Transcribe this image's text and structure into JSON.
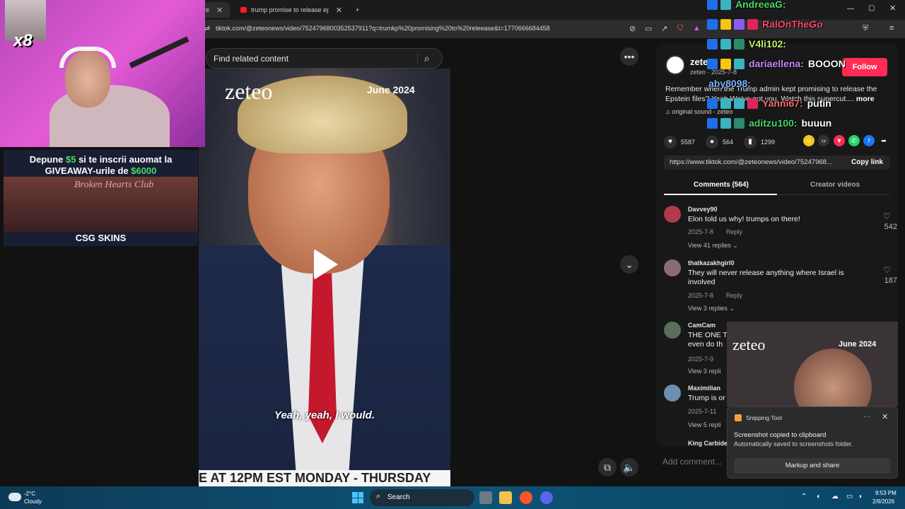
{
  "browser": {
    "tabs": [
      {
        "label": "re",
        "active": true
      },
      {
        "label": "trump promise to release epstein file",
        "active": false
      }
    ],
    "new_tab": "+",
    "url": "tiktok.com/@zeteonews/video/7524796800352537911?q=trumkp%20promising%20to%20releease&t=1770666684458"
  },
  "search": {
    "placeholder": "Find related content"
  },
  "video": {
    "brand": "zeteo",
    "date": "June 2024",
    "caption": "Yeah, yeah, I would.",
    "ticker": "E AT 12PM EST MONDAY - THURSDAY"
  },
  "post": {
    "author": "zete",
    "author_sub": "zeteo · 2025-7-8",
    "follow_label": "Follow",
    "description": "Remember when the Trump admin kept promising to release the Epstein files? Yeah We've got you. Watch this supercut....",
    "more_label": "more",
    "sound": "original sound - zeteo",
    "stats": {
      "likes": "5587",
      "comments": "564",
      "saves": "1299"
    },
    "link": "https://www.tiktok.com/@zeteonews/video/75247968...",
    "copy_link": "Copy link",
    "tab_comments": "Comments (564)",
    "tab_creator": "Creator videos",
    "add_comment": "Add comment..."
  },
  "comments": [
    {
      "user": "Davvey90",
      "text": "Elon told us why! trumps on there!",
      "date": "2025-7-8",
      "reply": "Reply",
      "replies": "View 41 replies",
      "likes": "542",
      "color": "#b23a48"
    },
    {
      "user": "thatkazakhgirl0",
      "text": "They will never release anything where Israel is involved",
      "date": "2025-7-8",
      "reply": "Reply",
      "replies": "View 3 replies",
      "likes": "187",
      "color": "#8a6c73"
    },
    {
      "user": "CamCam",
      "text": "THE ONE T even do th",
      "date": "2025-7-9",
      "reply": "",
      "replies": "View 3 repli",
      "likes": "",
      "color": "#596f5a"
    },
    {
      "user": "Maximilian",
      "text": "Trump is or",
      "date": "2025-7-11",
      "reply": "",
      "replies": "View 5 repli",
      "likes": "",
      "color": "#6c8fb0"
    },
    {
      "user": "King Carbide",
      "text": "",
      "date": "",
      "reply": "",
      "replies": "",
      "likes": "",
      "color": "#777777"
    }
  ],
  "overlay": {
    "cam_multiplier": "x8",
    "ad": {
      "line1_a": "Depune ",
      "line1_b": "$5",
      "line1_c": " si te inscrii auomat la",
      "line2_a": "GIVEAWAY-urile de ",
      "line2_b": "$6000",
      "club": "Broken Hearts Club",
      "brand": "CSG SKINS"
    },
    "chat": [
      {
        "user": "AndreeaG:",
        "msg": "",
        "color": "#4ad96a"
      },
      {
        "user": "RalOnTheGo",
        "msg": "",
        "color": "#ff4d6d"
      },
      {
        "user": "V4li102:",
        "msg": "",
        "color": "#bff36a"
      },
      {
        "user": "dariaellena:",
        "msg": "BOOON",
        "color": "#c58cff"
      },
      {
        "user": "aby8098:",
        "msg": "",
        "color": "#7fb5ff"
      },
      {
        "user": "Yanni67:",
        "msg": "putin",
        "color": "#ff6b6b"
      },
      {
        "user": "aditzu100:",
        "msg": "buuun",
        "color": "#4ad96a"
      }
    ]
  },
  "mini_player": {
    "brand": "zeteo",
    "date": "June 2024"
  },
  "toast": {
    "app": "Snipping Tool",
    "title": "Screenshot copied to clipboard",
    "body": "Automatically saved to screenshots folder.",
    "button": "Markup and share"
  },
  "taskbar": {
    "temp": "-2°C",
    "condition": "Cloudy",
    "search": "Search",
    "time": "9:53 PM",
    "date": "2/9/2026"
  }
}
